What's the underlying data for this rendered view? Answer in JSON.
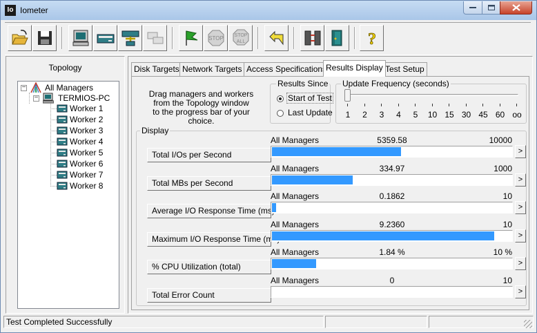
{
  "window": {
    "title": "Iometer",
    "app_icon": "Io"
  },
  "toolbar": {
    "buttons": [
      {
        "name": "open-config",
        "icon": "folder-open-icon"
      },
      {
        "name": "save-config",
        "icon": "floppy-disk-icon"
      },
      {
        "name": "start-disk-worker",
        "icon": "disk-worker-icon"
      },
      {
        "name": "start-network-worker",
        "icon": "network-worker-icon"
      },
      {
        "name": "add-manager",
        "icon": "add-manager-icon"
      },
      {
        "name": "duplicate-worker",
        "icon": "duplicate-worker-icon"
      },
      {
        "name": "start-tests",
        "icon": "green-flag-icon"
      },
      {
        "name": "stop-test",
        "icon": "stop-sign-icon",
        "label": "STOP"
      },
      {
        "name": "stop-all",
        "icon": "stop-all-icon",
        "label_top": "STOP",
        "label_bottom": "ALL"
      },
      {
        "name": "reset-workers",
        "icon": "reset-arrow-icon"
      },
      {
        "name": "disconnect-workers",
        "icon": "disconnect-icon"
      },
      {
        "name": "exit",
        "icon": "exit-door-icon"
      },
      {
        "name": "about",
        "icon": "question-mark-icon",
        "label": "?"
      }
    ]
  },
  "topology": {
    "label": "Topology",
    "root": "All Managers",
    "manager": "TERMIOS-PC",
    "workers": [
      "Worker 1",
      "Worker 2",
      "Worker 3",
      "Worker 4",
      "Worker 5",
      "Worker 6",
      "Worker 7",
      "Worker 8"
    ]
  },
  "tabs": [
    {
      "label": "Disk Targets",
      "active": false
    },
    {
      "label": "Network Targets",
      "active": false
    },
    {
      "label": "Access Specifications",
      "active": false
    },
    {
      "label": "Results Display",
      "active": true
    },
    {
      "label": "Test Setup",
      "active": false
    }
  ],
  "results": {
    "instructions": [
      "Drag managers and workers",
      "from the Topology window",
      "to the progress bar of your choice."
    ],
    "results_since": {
      "title": "Results Since",
      "options": [
        "Start of Test",
        "Last Update"
      ],
      "selected": "Start of Test"
    },
    "update_frequency": {
      "title": "Update Frequency (seconds)",
      "ticks": [
        "1",
        "2",
        "3",
        "4",
        "5",
        "10",
        "15",
        "30",
        "45",
        "60",
        "oo"
      ],
      "selected": "1"
    },
    "display_title": "Display",
    "metrics": [
      {
        "label": "Total I/Os per Second",
        "manager": "All Managers",
        "value": "5359.58",
        "max": "10000",
        "fraction": 0.536
      },
      {
        "label": "Total MBs per Second",
        "manager": "All Managers",
        "value": "334.97",
        "max": "1000",
        "fraction": 0.335
      },
      {
        "label": "Average I/O Response Time (ms)",
        "manager": "All Managers",
        "value": "0.1862",
        "max": "10",
        "fraction": 0.0186
      },
      {
        "label": "Maximum I/O Response Time (ms)",
        "manager": "All Managers",
        "value": "9.2360",
        "max": "10",
        "fraction": 0.9236
      },
      {
        "label": "% CPU Utilization (total)",
        "manager": "All Managers",
        "value": "1.84 %",
        "max": "10 %",
        "fraction": 0.184
      },
      {
        "label": "Total Error Count",
        "manager": "All Managers",
        "value": "0",
        "max": "10",
        "fraction": 0
      }
    ],
    "more_label": ">"
  },
  "status": {
    "text": "Test Completed Successfully"
  }
}
